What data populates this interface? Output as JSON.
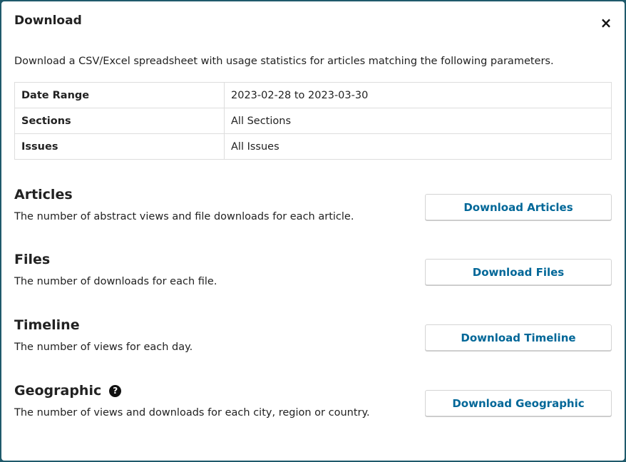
{
  "modal": {
    "title": "Download",
    "close_glyph": "×",
    "intro": "Download a CSV/Excel spreadsheet with usage statistics for articles matching the following parameters."
  },
  "params": [
    {
      "label": "Date Range",
      "value": "2023-02-28 to 2023-03-30"
    },
    {
      "label": "Sections",
      "value": "All Sections"
    },
    {
      "label": "Issues",
      "value": "All Issues"
    }
  ],
  "reports": [
    {
      "title": "Articles",
      "description": "The number of abstract views and file downloads for each article.",
      "button": "Download Articles"
    },
    {
      "title": "Files",
      "description": "The number of downloads for each file.",
      "button": "Download Files"
    },
    {
      "title": "Timeline",
      "description": "The number of views for each day.",
      "button": "Download Timeline"
    },
    {
      "title": "Geographic",
      "description": "The number of views and downloads for each city, region or country.",
      "button": "Download Geographic",
      "help_icon": "question-circle-icon",
      "help_glyph": "?"
    }
  ],
  "colors": {
    "backdrop": "#1f5a6b",
    "button_text": "#006798"
  }
}
